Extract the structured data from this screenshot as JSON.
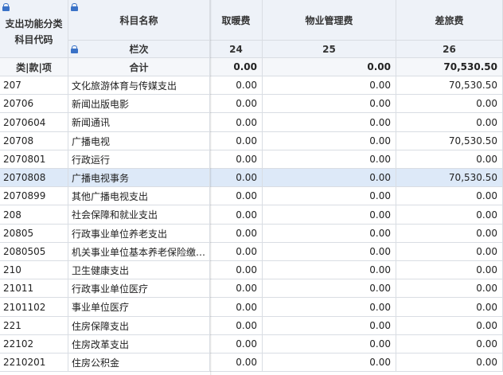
{
  "header": {
    "code_col": "支出功能分类科目代码",
    "name_col": "科目名称",
    "col_a": "取暖费",
    "col_b": "物业管理费",
    "col_c": "差旅费",
    "index_label": "栏次",
    "idx_a": "24",
    "idx_b": "25",
    "idx_c": "26",
    "code_sub": "类|款|项",
    "total_label": "合计",
    "total_a": "0.00",
    "total_b": "0.00",
    "total_c": "70,530.50"
  },
  "rows": [
    {
      "code": "207",
      "name": "文化旅游体育与传媒支出",
      "a": "0.00",
      "b": "0.00",
      "c": "70,530.50"
    },
    {
      "code": "20706",
      "name": "新闻出版电影",
      "a": "0.00",
      "b": "0.00",
      "c": "0.00"
    },
    {
      "code": "2070604",
      "name": "新闻通讯",
      "a": "0.00",
      "b": "0.00",
      "c": "0.00"
    },
    {
      "code": "20708",
      "name": "广播电视",
      "a": "0.00",
      "b": "0.00",
      "c": "70,530.50"
    },
    {
      "code": "2070801",
      "name": "行政运行",
      "a": "0.00",
      "b": "0.00",
      "c": "0.00"
    },
    {
      "code": "2070808",
      "name": "广播电视事务",
      "a": "0.00",
      "b": "0.00",
      "c": "70,530.50"
    },
    {
      "code": "2070899",
      "name": "其他广播电视支出",
      "a": "0.00",
      "b": "0.00",
      "c": "0.00"
    },
    {
      "code": "208",
      "name": "社会保障和就业支出",
      "a": "0.00",
      "b": "0.00",
      "c": "0.00"
    },
    {
      "code": "20805",
      "name": "行政事业单位养老支出",
      "a": "0.00",
      "b": "0.00",
      "c": "0.00"
    },
    {
      "code": "2080505",
      "name": "机关事业单位基本养老保险缴…",
      "a": "0.00",
      "b": "0.00",
      "c": "0.00"
    },
    {
      "code": "210",
      "name": "卫生健康支出",
      "a": "0.00",
      "b": "0.00",
      "c": "0.00"
    },
    {
      "code": "21011",
      "name": "行政事业单位医疗",
      "a": "0.00",
      "b": "0.00",
      "c": "0.00"
    },
    {
      "code": "2101102",
      "name": "事业单位医疗",
      "a": "0.00",
      "b": "0.00",
      "c": "0.00"
    },
    {
      "code": "221",
      "name": "住房保障支出",
      "a": "0.00",
      "b": "0.00",
      "c": "0.00"
    },
    {
      "code": "22102",
      "name": "住房改革支出",
      "a": "0.00",
      "b": "0.00",
      "c": "0.00"
    },
    {
      "code": "2210201",
      "name": "住房公积金",
      "a": "0.00",
      "b": "0.00",
      "c": "0.00"
    }
  ],
  "selected_row_index": 5,
  "colors": {
    "accent": "#3a72c7",
    "selected": "#dde9f8",
    "header": "#eef2f8"
  },
  "icons": [
    "lock-icon"
  ]
}
